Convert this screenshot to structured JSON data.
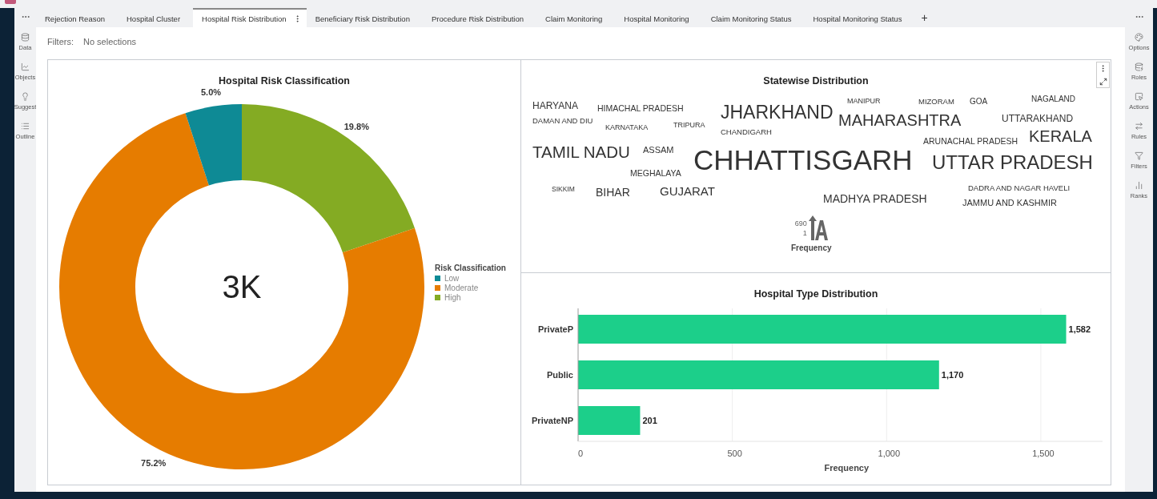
{
  "tabs": [
    {
      "label": "Rejection Reason",
      "selected": false
    },
    {
      "label": "Hospital Cluster",
      "selected": false
    },
    {
      "label": "Hospital Risk Distribution",
      "selected": true
    },
    {
      "label": "Beneficiary Risk Distribution",
      "selected": false
    },
    {
      "label": "Procedure Risk Distribution",
      "selected": false
    },
    {
      "label": "Claim Monitoring",
      "selected": false
    },
    {
      "label": "Hospital Monitoring",
      "selected": false
    },
    {
      "label": "Claim Monitoring Status",
      "selected": false
    },
    {
      "label": "Hospital Monitoring Status",
      "selected": false
    }
  ],
  "add_tab": "+",
  "left_toolbar": [
    "Data",
    "Objects",
    "Suggest",
    "Outline"
  ],
  "right_toolbar": [
    "Options",
    "Roles",
    "Actions",
    "Rules",
    "Filters",
    "Ranks"
  ],
  "filters": {
    "label": "Filters:",
    "value": "No selections"
  },
  "risk_panel": {
    "center_label": "3K",
    "chart_data": {
      "type": "donut",
      "title": "Hospital Risk Classification",
      "categories": [
        "Low",
        "Moderate",
        "High"
      ],
      "values": [
        5.0,
        75.2,
        19.8
      ],
      "value_labels": [
        "5.0%",
        "75.2%",
        "19.8%"
      ]
    },
    "legend": {
      "title": "Risk Classification",
      "items": [
        {
          "color": "#0e8a95"
        },
        {
          "color": "#e67c00"
        },
        {
          "color": "#84ab23"
        }
      ]
    }
  },
  "state_panel": {
    "title": "Statewise Distribution",
    "words": [
      "HARYANA",
      "HIMACHAL PRADESH",
      "JHARKHAND",
      "MANIPUR",
      "MIZORAM",
      "GOA",
      "NAGALAND",
      "DAMAN AND DIU",
      "KARNATAKA",
      "TRIPURA",
      "CHANDIGARH",
      "MAHARASHTRA",
      "UTTARAKHAND",
      "ARUNACHAL PRADESH",
      "KERALA",
      "TAMIL NADU",
      "ASSAM",
      "CHHATTISGARH",
      "UTTAR PRADESH",
      "MEGHALAYA",
      "SIKKIM",
      "BIHAR",
      "GUJARAT",
      "MADHYA PRADESH",
      "DADRA AND NAGAR HAVELI",
      "JAMMU AND KASHMIR"
    ],
    "legend": {
      "max": "690",
      "min": "1",
      "label": "Frequency"
    }
  },
  "type_panel": {
    "chart_data": {
      "type": "bar",
      "orientation": "horizontal",
      "title": "Hospital Type Distribution",
      "xlabel": "Frequency",
      "categories": [
        "PrivateP",
        "Public",
        "PrivateNP"
      ],
      "series": [
        {
          "color": "#1ccf8a",
          "values": [
            1582,
            1170,
            201
          ]
        }
      ],
      "grid": true,
      "xlim": [
        0,
        1700
      ],
      "xticks": [
        0,
        500,
        {
          "value": 1000,
          "label": "1,000"
        },
        {
          "value": 1500,
          "label": "1,500"
        }
      ],
      "value_labels": [
        "1,582",
        "1,170",
        "201"
      ]
    }
  }
}
